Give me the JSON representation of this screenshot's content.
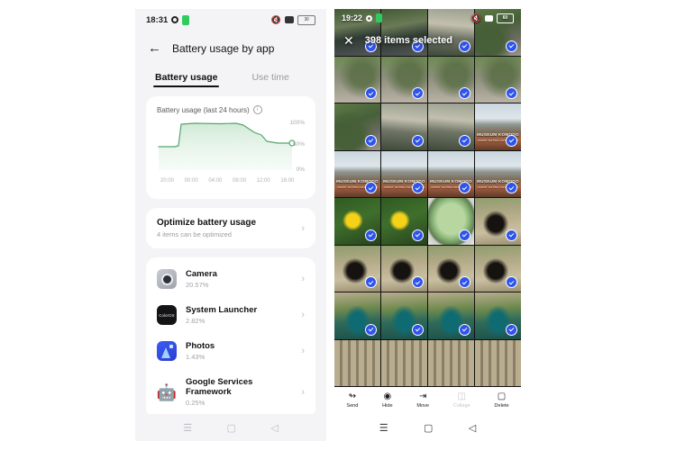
{
  "left_phone": {
    "status_bar": {
      "time": "18:31",
      "gear_icon": "gear-icon",
      "green_icon": "green-indicator-icon",
      "mute_icon": "mute-icon",
      "camera_icon": "camera-status-icon",
      "battery_text": "30"
    },
    "header": {
      "back_icon": "back-arrow-icon",
      "title": "Battery usage by app"
    },
    "tabs": [
      {
        "label": "Battery usage",
        "active": true
      },
      {
        "label": "Use time",
        "active": false
      }
    ],
    "chart_card": {
      "title": "Battery usage (last 24 hours)",
      "info_icon": "info-icon"
    },
    "optimize_card": {
      "title": "Optimize battery usage",
      "subtitle": "4 items can be optimized",
      "chevron_icon": "chevron-right-icon"
    },
    "apps": [
      {
        "name": "Camera",
        "percent": "20.57%",
        "icon": "camera-app-icon"
      },
      {
        "name": "System Launcher",
        "percent": "2.82%",
        "icon": "launcher-app-icon"
      },
      {
        "name": "Photos",
        "percent": "1.43%",
        "icon": "photos-app-icon"
      },
      {
        "name": "Google Services Framework",
        "percent": "0.25%",
        "icon": "android-app-icon"
      }
    ],
    "nav_bar": [
      {
        "icon": "recents-icon",
        "glyph": "☰"
      },
      {
        "icon": "home-icon",
        "glyph": "▢"
      },
      {
        "icon": "back-icon",
        "glyph": "◁"
      }
    ]
  },
  "right_phone": {
    "status_bar": {
      "time": "19:22",
      "gear_icon": "gear-icon",
      "green_icon": "green-indicator-icon",
      "mute_icon": "mute-icon",
      "camera_icon": "camera-status-icon",
      "battery_text": "60"
    },
    "selection_header": {
      "close_icon": "close-icon",
      "count_label": "398 items selected"
    },
    "grid": {
      "columns": 4,
      "all_selected": true,
      "check_icon": "check-circle-icon",
      "museum_caption": "MUSEUM KOMODO",
      "museum_subcaption": "JAWAT SATWA NUSANTARA",
      "cells": [
        {
          "theme": "art-pond",
          "selected": true
        },
        {
          "theme": "art-pond",
          "selected": true
        },
        {
          "theme": "art-enclosure",
          "selected": true
        },
        {
          "theme": "art-komodo",
          "selected": true
        },
        {
          "theme": "art-komodo2",
          "selected": true
        },
        {
          "theme": "art-komodo2",
          "selected": true
        },
        {
          "theme": "art-komodo2",
          "selected": true
        },
        {
          "theme": "art-komodo2",
          "selected": true
        },
        {
          "theme": "art-komodo",
          "selected": true
        },
        {
          "theme": "art-enclosure",
          "selected": true
        },
        {
          "theme": "art-enclosure",
          "selected": true
        },
        {
          "theme": "art-museum",
          "selected": true,
          "caption": true
        },
        {
          "theme": "art-museum",
          "selected": true,
          "caption": true
        },
        {
          "theme": "art-museum",
          "selected": true,
          "caption": true
        },
        {
          "theme": "art-museum",
          "selected": true,
          "caption": true
        },
        {
          "theme": "art-museum",
          "selected": true,
          "caption": true
        },
        {
          "theme": "art-flower",
          "selected": true
        },
        {
          "theme": "art-flower",
          "selected": true
        },
        {
          "theme": "art-leaf",
          "selected": true
        },
        {
          "theme": "art-bird",
          "selected": true
        },
        {
          "theme": "art-bird",
          "selected": true
        },
        {
          "theme": "art-bird",
          "selected": true
        },
        {
          "theme": "art-bird",
          "selected": true
        },
        {
          "theme": "art-bird",
          "selected": true
        },
        {
          "theme": "art-peacock",
          "selected": true
        },
        {
          "theme": "art-peacock",
          "selected": true
        },
        {
          "theme": "art-peacock",
          "selected": true
        },
        {
          "theme": "art-peacock",
          "selected": true
        },
        {
          "theme": "art-fence",
          "selected": false
        },
        {
          "theme": "art-fence",
          "selected": false
        },
        {
          "theme": "art-fence",
          "selected": false
        },
        {
          "theme": "art-fence",
          "selected": false
        }
      ]
    },
    "toolbar": [
      {
        "label": "Send",
        "icon": "share-icon",
        "glyph": "≪",
        "disabled": false
      },
      {
        "label": "Hide",
        "icon": "eye-off-icon",
        "glyph": "◉",
        "disabled": false
      },
      {
        "label": "Move",
        "icon": "move-to-icon",
        "glyph": "→",
        "disabled": false
      },
      {
        "label": "Collage",
        "icon": "collage-icon",
        "glyph": "▥",
        "disabled": true
      },
      {
        "label": "Delete",
        "icon": "trash-icon",
        "glyph": "Ὕ1",
        "disabled": false
      }
    ],
    "nav_bar": [
      {
        "icon": "recents-icon",
        "glyph": "☰"
      },
      {
        "icon": "home-icon",
        "glyph": "▢"
      },
      {
        "icon": "back-icon",
        "glyph": "◁"
      }
    ]
  },
  "chart_data": {
    "type": "area",
    "title": "Battery usage (last 24 hours)",
    "xlabel": "",
    "ylabel": "",
    "ylim": [
      0,
      100
    ],
    "ytick_labels": [
      "100%",
      "50%",
      "0%"
    ],
    "yticks": [
      100,
      50,
      0
    ],
    "xtick_labels": [
      "20:00",
      "00:00",
      "04:00",
      "08:00",
      "12:00",
      "16:00"
    ],
    "grid": false,
    "legend": null,
    "line_color": "#4aa06a",
    "fill_color": "#dff0e3",
    "marker": {
      "x": "18:00",
      "y": 58,
      "style": "open-circle"
    },
    "x": [
      19,
      20,
      21,
      22,
      23,
      0,
      1,
      2,
      3,
      4,
      5,
      6,
      7,
      8,
      9,
      10,
      11,
      12,
      13,
      14,
      15,
      16,
      17,
      18
    ],
    "values": [
      54,
      54,
      54,
      54,
      55,
      96,
      97,
      97,
      96,
      96,
      96,
      96,
      96,
      96,
      96,
      95,
      92,
      85,
      80,
      74,
      66,
      62,
      60,
      58
    ]
  }
}
